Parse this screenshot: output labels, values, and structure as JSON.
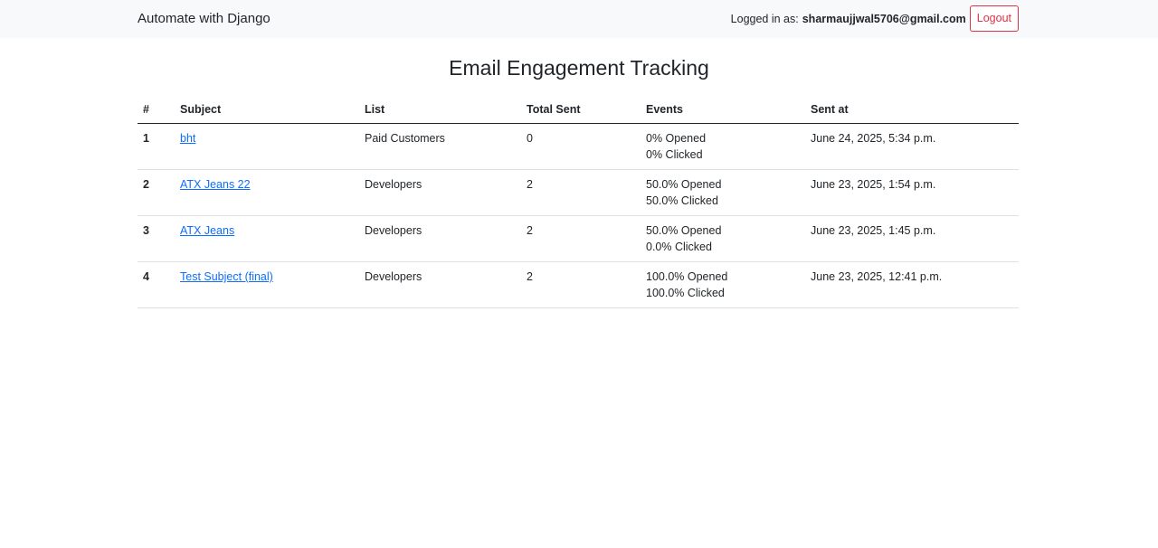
{
  "navbar": {
    "brand": "Automate with Django",
    "login_label": "Logged in as:",
    "user_email": "sharmaujjwal5706@gmail.com",
    "logout_label": "Logout"
  },
  "page": {
    "title": "Email Engagement Tracking"
  },
  "table": {
    "headers": [
      "#",
      "Subject",
      "List",
      "Total Sent",
      "Events",
      "Sent at"
    ],
    "rows": [
      {
        "num": "1",
        "subject": "bht",
        "list": "Paid Customers",
        "total_sent": "0",
        "opened": "0% Opened",
        "clicked": "0% Clicked",
        "sent_at": "June 24, 2025, 5:34 p.m."
      },
      {
        "num": "2",
        "subject": "ATX Jeans 22",
        "list": "Developers",
        "total_sent": "2",
        "opened": "50.0% Opened",
        "clicked": "50.0% Clicked",
        "sent_at": "June 23, 2025, 1:54 p.m."
      },
      {
        "num": "3",
        "subject": "ATX Jeans",
        "list": "Developers",
        "total_sent": "2",
        "opened": "50.0% Opened",
        "clicked": "0.0% Clicked",
        "sent_at": "June 23, 2025, 1:45 p.m."
      },
      {
        "num": "4",
        "subject": "Test Subject (final)",
        "list": "Developers",
        "total_sent": "2",
        "opened": "100.0% Opened",
        "clicked": "100.0% Clicked",
        "sent_at": "June 23, 2025, 12:41 p.m."
      }
    ]
  },
  "colors": {
    "navbar_bg": "#f8f9fa",
    "link": "#0d6efd",
    "danger": "#dc3545",
    "text": "#212529"
  }
}
